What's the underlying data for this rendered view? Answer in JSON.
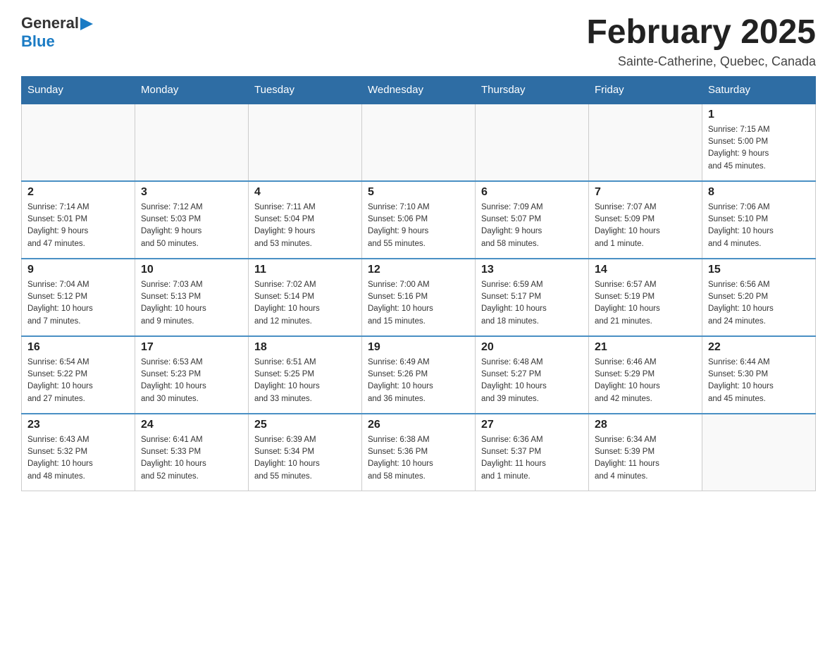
{
  "header": {
    "logo_general": "General",
    "logo_blue": "Blue",
    "month_title": "February 2025",
    "location": "Sainte-Catherine, Quebec, Canada"
  },
  "weekdays": [
    "Sunday",
    "Monday",
    "Tuesday",
    "Wednesday",
    "Thursday",
    "Friday",
    "Saturday"
  ],
  "weeks": [
    [
      {
        "day": "",
        "info": ""
      },
      {
        "day": "",
        "info": ""
      },
      {
        "day": "",
        "info": ""
      },
      {
        "day": "",
        "info": ""
      },
      {
        "day": "",
        "info": ""
      },
      {
        "day": "",
        "info": ""
      },
      {
        "day": "1",
        "info": "Sunrise: 7:15 AM\nSunset: 5:00 PM\nDaylight: 9 hours\nand 45 minutes."
      }
    ],
    [
      {
        "day": "2",
        "info": "Sunrise: 7:14 AM\nSunset: 5:01 PM\nDaylight: 9 hours\nand 47 minutes."
      },
      {
        "day": "3",
        "info": "Sunrise: 7:12 AM\nSunset: 5:03 PM\nDaylight: 9 hours\nand 50 minutes."
      },
      {
        "day": "4",
        "info": "Sunrise: 7:11 AM\nSunset: 5:04 PM\nDaylight: 9 hours\nand 53 minutes."
      },
      {
        "day": "5",
        "info": "Sunrise: 7:10 AM\nSunset: 5:06 PM\nDaylight: 9 hours\nand 55 minutes."
      },
      {
        "day": "6",
        "info": "Sunrise: 7:09 AM\nSunset: 5:07 PM\nDaylight: 9 hours\nand 58 minutes."
      },
      {
        "day": "7",
        "info": "Sunrise: 7:07 AM\nSunset: 5:09 PM\nDaylight: 10 hours\nand 1 minute."
      },
      {
        "day": "8",
        "info": "Sunrise: 7:06 AM\nSunset: 5:10 PM\nDaylight: 10 hours\nand 4 minutes."
      }
    ],
    [
      {
        "day": "9",
        "info": "Sunrise: 7:04 AM\nSunset: 5:12 PM\nDaylight: 10 hours\nand 7 minutes."
      },
      {
        "day": "10",
        "info": "Sunrise: 7:03 AM\nSunset: 5:13 PM\nDaylight: 10 hours\nand 9 minutes."
      },
      {
        "day": "11",
        "info": "Sunrise: 7:02 AM\nSunset: 5:14 PM\nDaylight: 10 hours\nand 12 minutes."
      },
      {
        "day": "12",
        "info": "Sunrise: 7:00 AM\nSunset: 5:16 PM\nDaylight: 10 hours\nand 15 minutes."
      },
      {
        "day": "13",
        "info": "Sunrise: 6:59 AM\nSunset: 5:17 PM\nDaylight: 10 hours\nand 18 minutes."
      },
      {
        "day": "14",
        "info": "Sunrise: 6:57 AM\nSunset: 5:19 PM\nDaylight: 10 hours\nand 21 minutes."
      },
      {
        "day": "15",
        "info": "Sunrise: 6:56 AM\nSunset: 5:20 PM\nDaylight: 10 hours\nand 24 minutes."
      }
    ],
    [
      {
        "day": "16",
        "info": "Sunrise: 6:54 AM\nSunset: 5:22 PM\nDaylight: 10 hours\nand 27 minutes."
      },
      {
        "day": "17",
        "info": "Sunrise: 6:53 AM\nSunset: 5:23 PM\nDaylight: 10 hours\nand 30 minutes."
      },
      {
        "day": "18",
        "info": "Sunrise: 6:51 AM\nSunset: 5:25 PM\nDaylight: 10 hours\nand 33 minutes."
      },
      {
        "day": "19",
        "info": "Sunrise: 6:49 AM\nSunset: 5:26 PM\nDaylight: 10 hours\nand 36 minutes."
      },
      {
        "day": "20",
        "info": "Sunrise: 6:48 AM\nSunset: 5:27 PM\nDaylight: 10 hours\nand 39 minutes."
      },
      {
        "day": "21",
        "info": "Sunrise: 6:46 AM\nSunset: 5:29 PM\nDaylight: 10 hours\nand 42 minutes."
      },
      {
        "day": "22",
        "info": "Sunrise: 6:44 AM\nSunset: 5:30 PM\nDaylight: 10 hours\nand 45 minutes."
      }
    ],
    [
      {
        "day": "23",
        "info": "Sunrise: 6:43 AM\nSunset: 5:32 PM\nDaylight: 10 hours\nand 48 minutes."
      },
      {
        "day": "24",
        "info": "Sunrise: 6:41 AM\nSunset: 5:33 PM\nDaylight: 10 hours\nand 52 minutes."
      },
      {
        "day": "25",
        "info": "Sunrise: 6:39 AM\nSunset: 5:34 PM\nDaylight: 10 hours\nand 55 minutes."
      },
      {
        "day": "26",
        "info": "Sunrise: 6:38 AM\nSunset: 5:36 PM\nDaylight: 10 hours\nand 58 minutes."
      },
      {
        "day": "27",
        "info": "Sunrise: 6:36 AM\nSunset: 5:37 PM\nDaylight: 11 hours\nand 1 minute."
      },
      {
        "day": "28",
        "info": "Sunrise: 6:34 AM\nSunset: 5:39 PM\nDaylight: 11 hours\nand 4 minutes."
      },
      {
        "day": "",
        "info": ""
      }
    ]
  ]
}
